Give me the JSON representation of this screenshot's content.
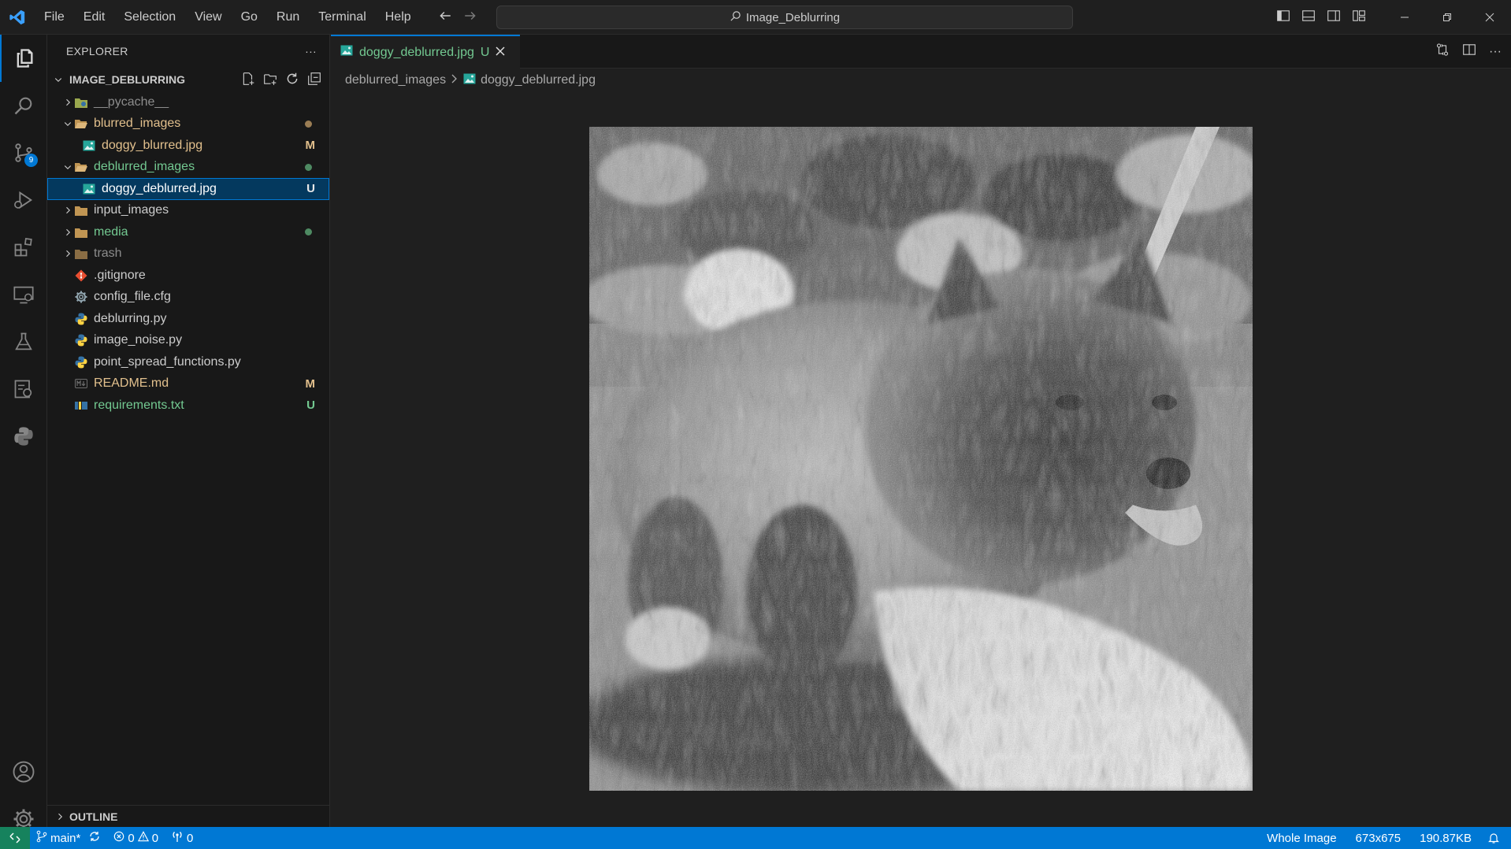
{
  "menu": [
    "File",
    "Edit",
    "Selection",
    "View",
    "Go",
    "Run",
    "Terminal",
    "Help"
  ],
  "search_title": "Image_Deblurring",
  "sidebar": {
    "title": "EXPLORER",
    "more": "···",
    "project": "IMAGE_DEBLURRING",
    "items": [
      {
        "label": "__pycache__",
        "kind": "folder-python",
        "color": "gray",
        "status": ""
      },
      {
        "label": "blurred_images",
        "kind": "folder",
        "color": "yellow",
        "status": "dot"
      },
      {
        "label": "doggy_blurred.jpg",
        "kind": "image",
        "color": "yellow",
        "status": "M"
      },
      {
        "label": "deblurred_images",
        "kind": "folder",
        "color": "green",
        "status": "dot"
      },
      {
        "label": "doggy_deblurred.jpg",
        "kind": "image",
        "color": "green",
        "status": "U"
      },
      {
        "label": "input_images",
        "kind": "folder",
        "color": "normal",
        "status": ""
      },
      {
        "label": "media",
        "kind": "folder",
        "color": "green",
        "status": "dot"
      },
      {
        "label": "trash",
        "kind": "folder",
        "color": "gray",
        "status": ""
      },
      {
        "label": ".gitignore",
        "kind": "git",
        "color": "normal",
        "status": ""
      },
      {
        "label": "config_file.cfg",
        "kind": "gear",
        "color": "normal",
        "status": ""
      },
      {
        "label": "deblurring.py",
        "kind": "python",
        "color": "normal",
        "status": ""
      },
      {
        "label": "image_noise.py",
        "kind": "python",
        "color": "normal",
        "status": ""
      },
      {
        "label": "point_spread_functions.py",
        "kind": "python",
        "color": "normal",
        "status": ""
      },
      {
        "label": "README.md",
        "kind": "markdown",
        "color": "yellow",
        "status": "M"
      },
      {
        "label": "requirements.txt",
        "kind": "text",
        "color": "green",
        "status": "U"
      }
    ],
    "outline": "OUTLINE"
  },
  "activity": {
    "scm_badge": "9"
  },
  "editor": {
    "tab_label": "doggy_deblurred.jpg",
    "tab_status": "U",
    "breadcrumb_folder": "deblurred_images",
    "breadcrumb_file": "doggy_deblurred.jpg"
  },
  "statusbar": {
    "branch": "main*",
    "errors": "0",
    "warnings": "0",
    "ports": "0",
    "zoom_mode": "Whole Image",
    "dimensions": "673x675",
    "size": "190.87KB"
  },
  "colors": {
    "accent": "#0078d4",
    "modified": "#e2c08d",
    "untracked": "#73c991"
  }
}
